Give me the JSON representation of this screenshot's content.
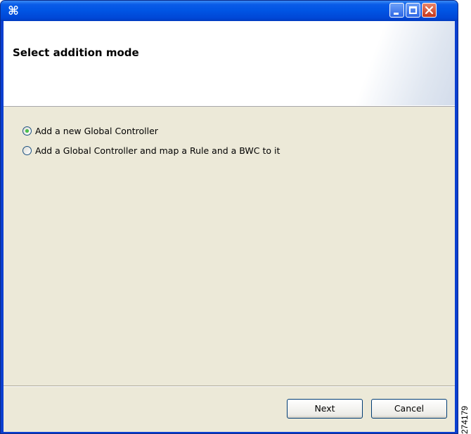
{
  "window": {
    "title": "",
    "app_icon": "application-icon",
    "controls": [
      "minimize-icon",
      "maximize-icon",
      "close-icon"
    ]
  },
  "header": {
    "title": "Select addition mode"
  },
  "options": [
    {
      "label": "Add a new Global Controller",
      "selected": true
    },
    {
      "label": "Add a Global Controller and map a Rule and a BWC to it",
      "selected": false
    }
  ],
  "buttons": {
    "next_label": "Next",
    "cancel_label": "Cancel"
  },
  "figure_number": "274179",
  "colors": {
    "titlebar": "#0054e3",
    "client_bg": "#ece9d8",
    "close_button": "#c5371b",
    "radio_selected": "#21a121"
  }
}
